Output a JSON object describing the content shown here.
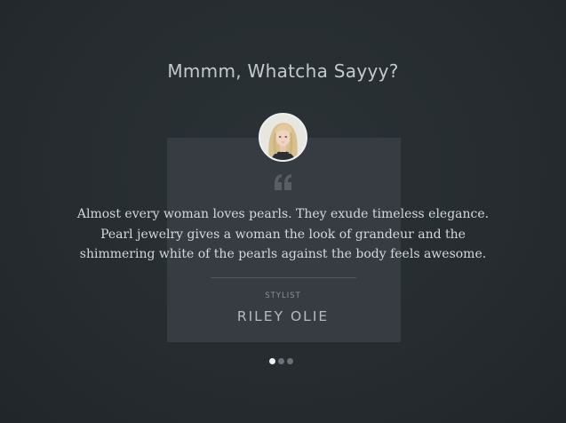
{
  "section": {
    "title": "Mmmm, Whatcha Sayyy?"
  },
  "testimonial": {
    "quote_icon": "quote-left-icon",
    "quote_lines": [
      "Almost every woman loves pearls. They exude timeless elegance.",
      "Pearl jewelry gives a woman the look of grandeur and the",
      "shimmering white of the pearls against the body feels awesome."
    ],
    "role": "STYLIST",
    "name": "RILEY OLIE"
  },
  "pagination": {
    "count": 3,
    "active_index": 0
  },
  "colors": {
    "background": "#262c30",
    "card": "#363c41",
    "title": "#c4c9cc",
    "quote_text": "#d4d8da",
    "dot_active": "#eef0f1",
    "dot_inactive": "#6b7176"
  }
}
